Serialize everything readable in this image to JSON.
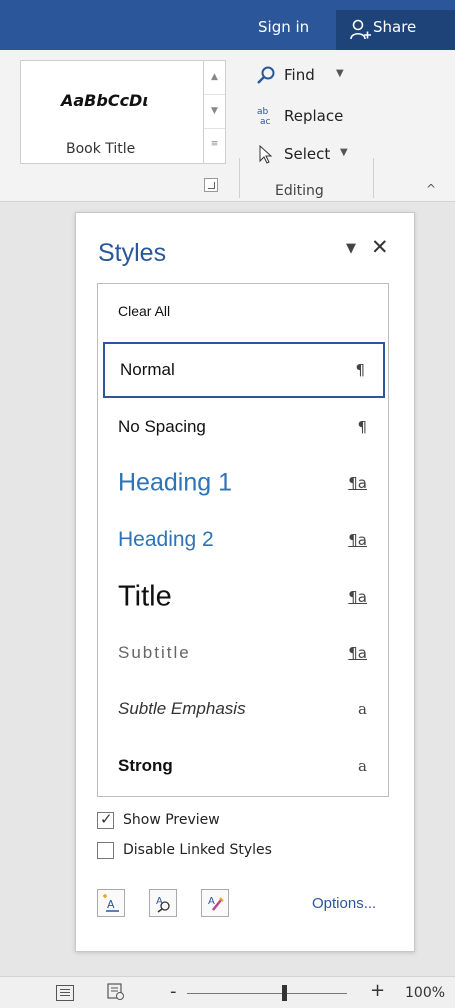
{
  "titlebar": {
    "signin_label": "Sign in",
    "share_label": "Share",
    "background": "#2b579a"
  },
  "ribbon": {
    "gallery": {
      "sample_text": "AaBbCcDι",
      "style_name": "Book Title"
    },
    "editing": {
      "find_label": "Find",
      "replace_label": "Replace",
      "select_label": "Select",
      "group_label": "Editing"
    }
  },
  "styles_pane": {
    "title": "Styles",
    "items": [
      {
        "label": "Clear All",
        "mark": ""
      },
      {
        "label": "Normal",
        "mark": "¶",
        "selected": true
      },
      {
        "label": "No Spacing",
        "mark": "¶"
      },
      {
        "label": "Heading 1",
        "mark": "¶a"
      },
      {
        "label": "Heading 2",
        "mark": "¶a"
      },
      {
        "label": "Title",
        "mark": "¶a"
      },
      {
        "label": "Subtitle",
        "mark": "¶a"
      },
      {
        "label": "Subtle Emphasis",
        "mark": "a"
      },
      {
        "label": "Strong",
        "mark": "a"
      }
    ],
    "show_preview": {
      "label": "Show Preview",
      "checked": true
    },
    "disable_linked": {
      "label": "Disable Linked Styles",
      "checked": false
    },
    "options_label": "Options...",
    "accent": "#2b579a",
    "heading_color": "#2e74b5"
  },
  "statusbar": {
    "zoom_out_label": "-",
    "zoom_in_label": "+",
    "zoom_level": "100%"
  }
}
